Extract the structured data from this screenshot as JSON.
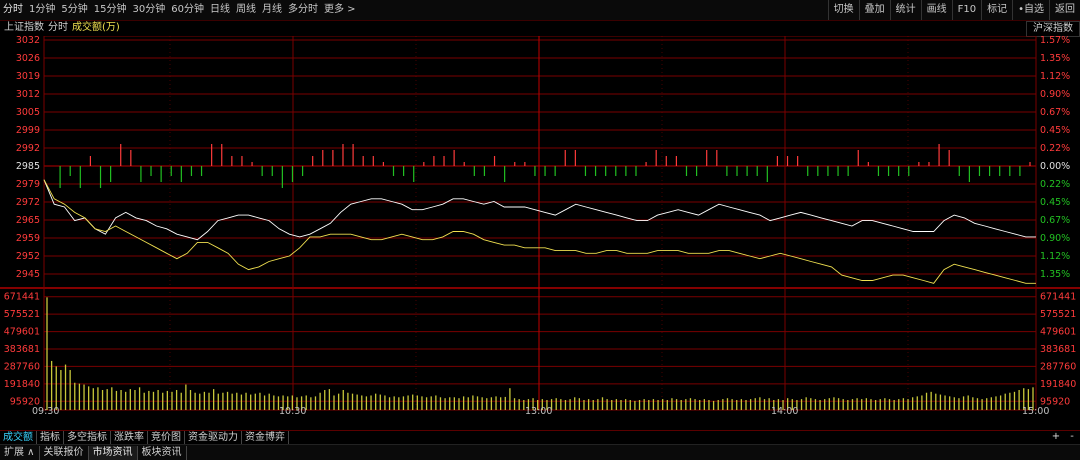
{
  "toolbar": {
    "periods": [
      "分时",
      "1分钟",
      "5分钟",
      "15分钟",
      "30分钟",
      "60分钟",
      "日线",
      "周线",
      "月线",
      "多分时",
      "更多 >"
    ],
    "active_period": "分时",
    "right_buttons": [
      "切换",
      "叠加",
      "统计",
      "画线",
      "F10",
      "标记",
      "•自选",
      "返回"
    ]
  },
  "subheader": {
    "index_name": "上证指数",
    "mode": "分时",
    "metric": "成交额(万)",
    "overlay_index": "沪深指数"
  },
  "colors": {
    "up": "#ff3b3b",
    "down": "#22c022",
    "grid": "#7a0000",
    "price_line": "#ffffff",
    "avg_line": "#f0e050",
    "volume": "#c8c83a",
    "active_tab": "#3ad5ff"
  },
  "chart_data": [
    {
      "type": "line",
      "price_axis": [
        "3032",
        "3026",
        "3019",
        "3012",
        "3005",
        "2999",
        "2992",
        "2985",
        "2979",
        "2972",
        "2965",
        "2959",
        "2952",
        "2945"
      ],
      "pct_axis": [
        "1.57%",
        "1.35%",
        "1.12%",
        "0.90%",
        "0.67%",
        "0.45%",
        "0.22%",
        "0.00%",
        "0.22%",
        "0.45%",
        "0.67%",
        "0.90%",
        "1.12%",
        "1.35%"
      ],
      "ylim": [
        2941,
        3032
      ],
      "baseline": 2985,
      "time_labels": [
        "09:30",
        "10:30",
        "13:00",
        "14:00",
        "15:00"
      ],
      "series": [
        {
          "values": [
            2980,
            2971,
            2970,
            2965,
            2966,
            2962,
            2960,
            2966,
            2968,
            2966,
            2965,
            2963,
            2962,
            2960,
            2959,
            2958,
            2961,
            2965,
            2966,
            2967,
            2967,
            2966,
            2965,
            2962,
            2960,
            2959,
            2960,
            2962,
            2964,
            2968,
            2971,
            2972,
            2973,
            2973,
            2972,
            2971,
            2969,
            2969,
            2970,
            2971,
            2973,
            2973,
            2972,
            2971,
            2972,
            2970,
            2970,
            2970,
            2969,
            2968,
            2967,
            2969,
            2971,
            2970,
            2969,
            2968,
            2967,
            2966,
            2965,
            2965,
            2967,
            2968,
            2969,
            2968,
            2967,
            2969,
            2971,
            2970,
            2969,
            2968,
            2967,
            2965,
            2966,
            2967,
            2968,
            2967,
            2966,
            2965,
            2964,
            2963,
            2965,
            2965,
            2964,
            2963,
            2962,
            2961,
            2961,
            2961,
            2965,
            2967,
            2966,
            2964,
            2963,
            2962,
            2961,
            2960,
            2959,
            2959
          ]
        },
        {
          "values": [
            2980,
            2973,
            2971,
            2968,
            2966,
            2962,
            2961,
            2963,
            2961,
            2959,
            2957,
            2955,
            2953,
            2951,
            2953,
            2957,
            2957,
            2955,
            2953,
            2949,
            2947,
            2948,
            2950,
            2951,
            2952,
            2955,
            2959,
            2959,
            2960,
            2960,
            2960,
            2959,
            2958,
            2958,
            2959,
            2960,
            2959,
            2958,
            2958,
            2959,
            2961,
            2961,
            2960,
            2958,
            2957,
            2956,
            2956,
            2955,
            2955,
            2955,
            2954,
            2954,
            2954,
            2953,
            2953,
            2954,
            2954,
            2953,
            2953,
            2953,
            2954,
            2954,
            2954,
            2953,
            2953,
            2953,
            2954,
            2954,
            2953,
            2952,
            2951,
            2952,
            2953,
            2952,
            2951,
            2950,
            2949,
            2948,
            2945,
            2944,
            2943,
            2943,
            2944,
            2945,
            2945,
            2944,
            2943,
            2942,
            2947,
            2949,
            2948,
            2947,
            2946,
            2945,
            2944,
            2943,
            2942,
            2942
          ]
        }
      ]
    },
    {
      "type": "bar",
      "title": "成交额(万)",
      "axis_labels": [
        "671441",
        "575521",
        "479601",
        "383681",
        "287760",
        "191840",
        "95920"
      ],
      "ylim": [
        0,
        671441
      ],
      "values": [
        620000,
        270000,
        240000,
        220000,
        250000,
        220000,
        150000,
        145000,
        140000,
        130000,
        120000,
        125000,
        110000,
        115000,
        125000,
        105000,
        110000,
        100000,
        115000,
        110000,
        125000,
        95000,
        105000,
        100000,
        110000,
        95000,
        105000,
        100000,
        110000,
        95000,
        140000,
        110000,
        95000,
        90000,
        100000,
        95000,
        115000,
        90000,
        95000,
        100000,
        90000,
        95000,
        85000,
        95000,
        85000,
        90000,
        95000,
        80000,
        90000,
        80000,
        75000,
        80000,
        75000,
        80000,
        70000,
        75000,
        80000,
        70000,
        75000,
        95000,
        110000,
        115000,
        80000,
        90000,
        110000,
        95000,
        90000,
        85000,
        80000,
        75000,
        80000,
        90000,
        85000,
        80000,
        70000,
        75000,
        70000,
        75000,
        80000,
        85000,
        80000,
        75000,
        70000,
        75000,
        80000,
        70000,
        65000,
        70000,
        70000,
        65000,
        75000,
        70000,
        80000,
        75000,
        70000,
        65000,
        70000,
        75000,
        70000,
        72000,
        120000,
        65000,
        60000,
        55000,
        60000,
        65000,
        55000,
        60000,
        55000,
        60000,
        65000,
        60000,
        55000,
        60000,
        70000,
        65000,
        55000,
        60000,
        55000,
        60000,
        70000,
        60000,
        55000,
        60000,
        55000,
        60000,
        55000,
        50000,
        55000,
        60000,
        55000,
        60000,
        55000,
        60000,
        55000,
        65000,
        60000,
        55000,
        60000,
        65000,
        60000,
        55000,
        60000,
        55000,
        50000,
        55000,
        60000,
        65000,
        60000,
        55000,
        60000,
        55000,
        60000,
        65000,
        70000,
        60000,
        65000,
        55000,
        60000,
        55000,
        65000,
        60000,
        55000,
        60000,
        70000,
        65000,
        60000,
        55000,
        60000,
        65000,
        70000,
        65000,
        60000,
        55000,
        60000,
        65000,
        60000,
        65000,
        60000,
        55000,
        60000,
        65000,
        60000,
        55000,
        60000,
        65000,
        60000,
        70000,
        75000,
        80000,
        95000,
        100000,
        90000,
        85000,
        80000,
        75000,
        70000,
        65000,
        75000,
        80000,
        70000,
        65000,
        60000,
        65000,
        70000,
        75000,
        80000,
        90000,
        95000,
        100000,
        110000,
        120000,
        115000,
        125000
      ]
    }
  ],
  "bottom_tabs": {
    "indicators": [
      "成交额",
      "指标",
      "多空指标",
      "涨跌率",
      "竞价图",
      "资金驱动力",
      "资金博弈"
    ],
    "active_indicator": "成交额",
    "plus": "+",
    "minus": "-",
    "panels": [
      "扩展 ∧",
      "关联报价",
      "市场资讯",
      "板块资讯"
    ],
    "active_panel": "市场资讯"
  }
}
